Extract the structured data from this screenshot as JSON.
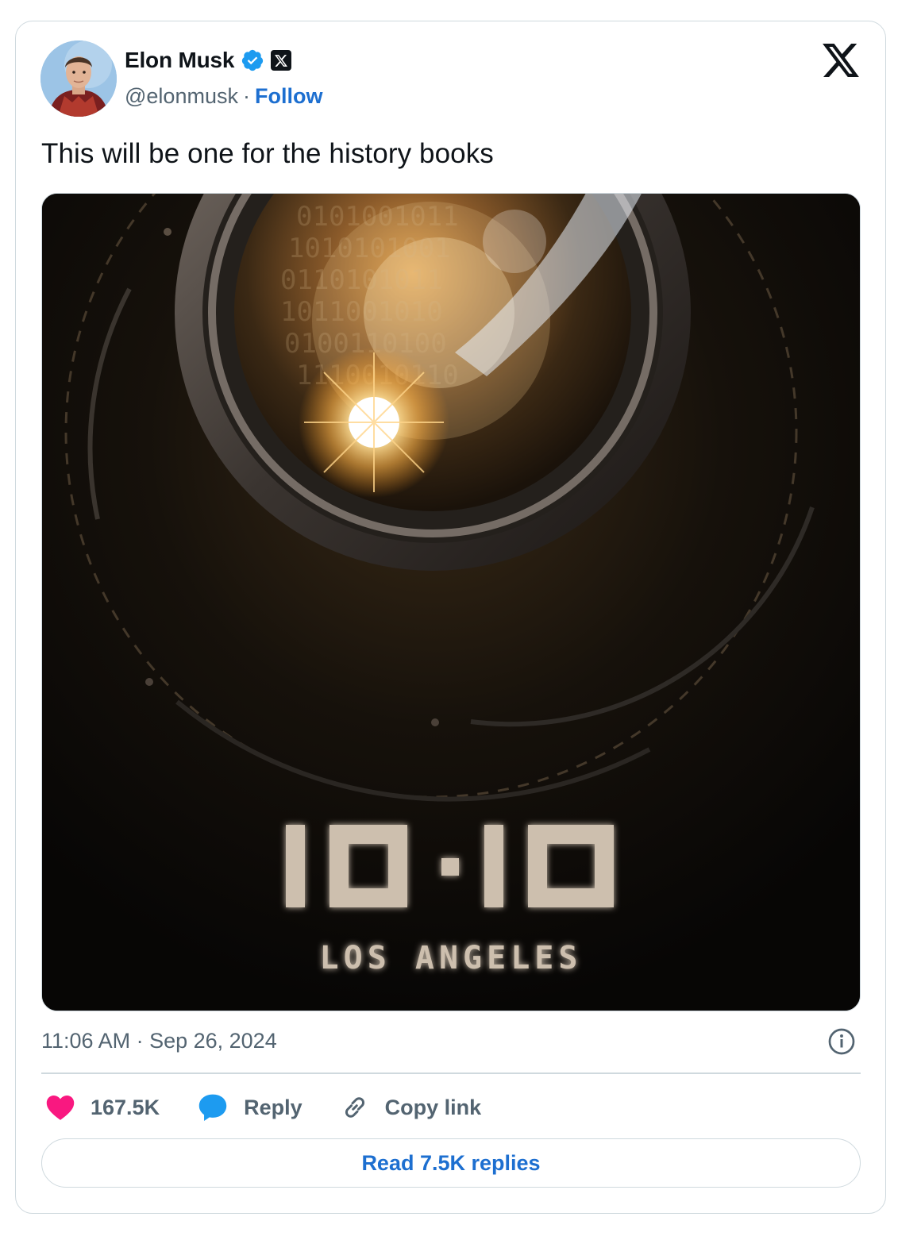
{
  "author": {
    "name": "Elon Musk",
    "handle": "@elonmusk",
    "separator": "·",
    "follow_label": "Follow"
  },
  "tweet": {
    "text": "This will be one for the history books",
    "timestamp": "11:06 AM · Sep 26, 2024"
  },
  "media": {
    "headline": "10·10",
    "location": "LOS ANGELES"
  },
  "actions": {
    "likes_count": "167.5K",
    "reply_label": "Reply",
    "copy_link_label": "Copy link"
  },
  "read_replies_label": "Read 7.5K replies",
  "colors": {
    "accent_blue": "#1d6fd0",
    "heart": "#f91880",
    "verified": "#1d9bf0",
    "muted": "#536471"
  },
  "icons": [
    "avatar",
    "verified-badge-icon",
    "x-affiliate-icon",
    "x-logo-icon",
    "info-icon",
    "heart-icon",
    "reply-icon",
    "link-icon"
  ]
}
